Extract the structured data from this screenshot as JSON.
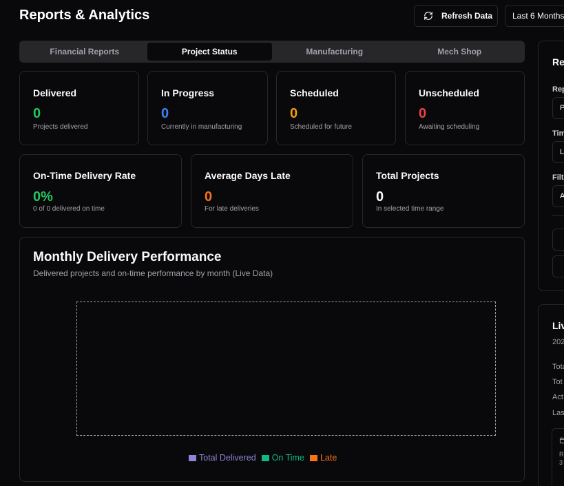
{
  "header": {
    "title": "Reports & Analytics",
    "refresh_label": "Refresh Data",
    "range_label": "Last 6 Months"
  },
  "tabs": [
    {
      "label": "Financial Reports",
      "active": false
    },
    {
      "label": "Project Status",
      "active": true
    },
    {
      "label": "Manufacturing",
      "active": false
    },
    {
      "label": "Mech Shop",
      "active": false
    }
  ],
  "status_cards": [
    {
      "label": "Delivered",
      "value": "0",
      "desc": "Projects delivered",
      "color": "#22c55e"
    },
    {
      "label": "In Progress",
      "value": "0",
      "desc": "Currently in manufacturing",
      "color": "#3b82f6"
    },
    {
      "label": "Scheduled",
      "value": "0",
      "desc": "Scheduled for future",
      "color": "#f59e0b"
    },
    {
      "label": "Unscheduled",
      "value": "0",
      "desc": "Awaiting scheduling",
      "color": "#ef4444"
    }
  ],
  "metric_cards": [
    {
      "label": "On-Time Delivery Rate",
      "value": "0%",
      "desc": "0 of 0 delivered on time",
      "color": "#22c55e"
    },
    {
      "label": "Average Days Late",
      "value": "0",
      "desc": "For late deliveries",
      "color": "#f97316"
    },
    {
      "label": "Total Projects",
      "value": "0",
      "desc": "In selected time range",
      "color": "#fafafa"
    }
  ],
  "performance": {
    "title": "Monthly Delivery Performance",
    "subtitle": "Delivered projects and on-time performance by month (Live Data)",
    "legend": [
      {
        "label": "Total Delivered",
        "color": "#8b84d7"
      },
      {
        "label": "On Time",
        "color": "#10b981"
      },
      {
        "label": "Late",
        "color": "#f97316"
      }
    ]
  },
  "side_panel": {
    "heading": "Re",
    "report_label": "Rep",
    "report_value": "P",
    "time_label": "Tim",
    "time_value": "L",
    "filter_label": "Filte",
    "filter_value": "A"
  },
  "side_live": {
    "heading": "Liv",
    "year": "202",
    "rows": [
      "Tota",
      "Tot",
      "Act",
      "Las"
    ],
    "note_line1": "R",
    "note_line2": "3"
  }
}
